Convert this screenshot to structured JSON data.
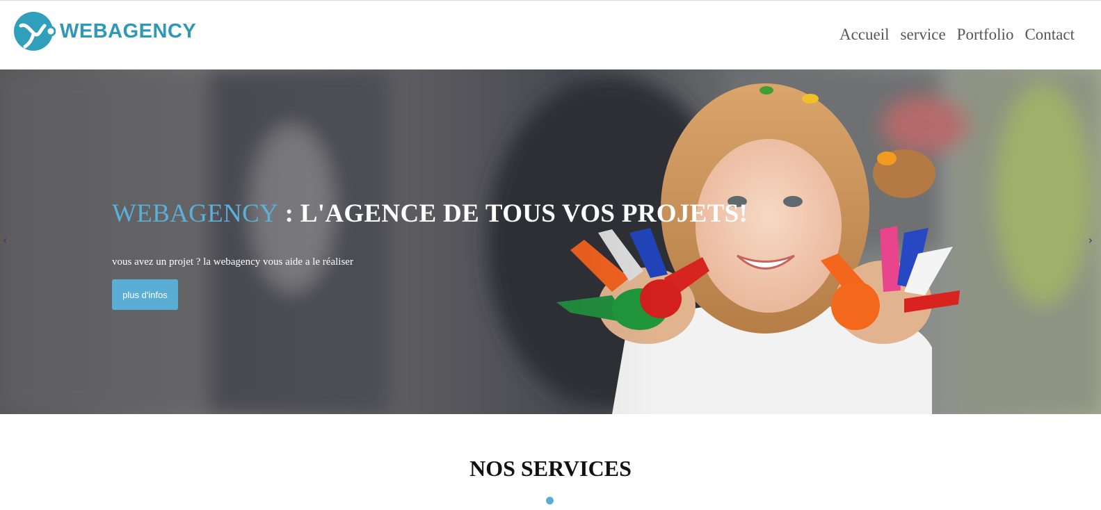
{
  "header": {
    "logo_text": "WEBAGENCY",
    "nav": [
      {
        "label": "Accueil"
      },
      {
        "label": "service"
      },
      {
        "label": "Portfolio"
      },
      {
        "label": "Contact"
      }
    ]
  },
  "hero": {
    "title_brand": "WEBAGENCY",
    "title_rest": " : L'AGENCE DE TOUS VOS PROJETS!",
    "subtitle": "vous avez un projet ? la webagency vous aide a le réaliser",
    "button_label": "plus d'infos",
    "prev_arrow": "‹",
    "next_arrow": "›"
  },
  "services": {
    "title": "NOS SERVICES"
  },
  "colors": {
    "brand": "#2f97b7",
    "accent": "#5aaed6"
  }
}
